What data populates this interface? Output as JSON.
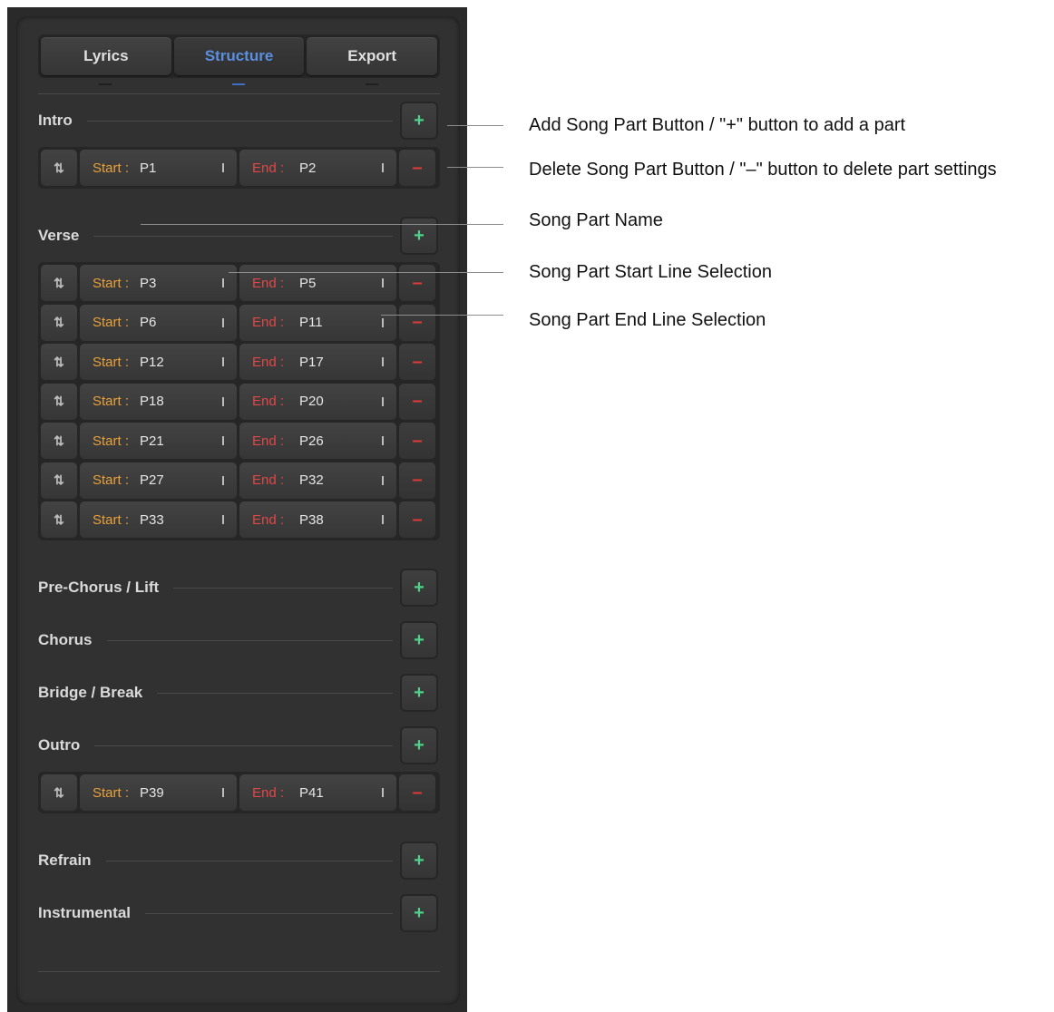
{
  "tabs": [
    {
      "label": "Lyrics",
      "active": false
    },
    {
      "label": "Structure",
      "active": true
    },
    {
      "label": "Export",
      "active": false
    }
  ],
  "ui": {
    "add_symbol": "+",
    "delete_symbol": "–",
    "move_symbol": "⇅",
    "start_label": "Start :",
    "end_label": "End :"
  },
  "sections": [
    {
      "name": "Intro",
      "parts": [
        {
          "start": "P1",
          "end": "P2"
        }
      ]
    },
    {
      "name": "Verse",
      "parts": [
        {
          "start": "P3",
          "end": "P5"
        },
        {
          "start": "P6",
          "end": "P11"
        },
        {
          "start": "P12",
          "end": "P17"
        },
        {
          "start": "P18",
          "end": "P20"
        },
        {
          "start": "P21",
          "end": "P26"
        },
        {
          "start": "P27",
          "end": "P32"
        },
        {
          "start": "P33",
          "end": "P38"
        }
      ]
    },
    {
      "name": "Pre-Chorus / Lift",
      "parts": []
    },
    {
      "name": "Chorus",
      "parts": []
    },
    {
      "name": "Bridge / Break",
      "parts": []
    },
    {
      "name": "Outro",
      "parts": [
        {
          "start": "P39",
          "end": "P41"
        }
      ]
    },
    {
      "name": "Refrain",
      "parts": []
    },
    {
      "name": "Instrumental",
      "parts": []
    }
  ],
  "annotations": [
    "Add Song Part Button / \"+\" button to add a part",
    "Delete Song Part Button / \"–\" button to delete part settings",
    "Song Part Name",
    "Song Part Start Line Selection",
    "Song Part End Line Selection"
  ],
  "colors": {
    "panel_bg": "#313131",
    "active_tab": "#5b8fe0",
    "start_label": "#e9a13a",
    "end_label": "#e04848",
    "add_green": "#4fd18a",
    "delete_red": "#e03a3a"
  }
}
